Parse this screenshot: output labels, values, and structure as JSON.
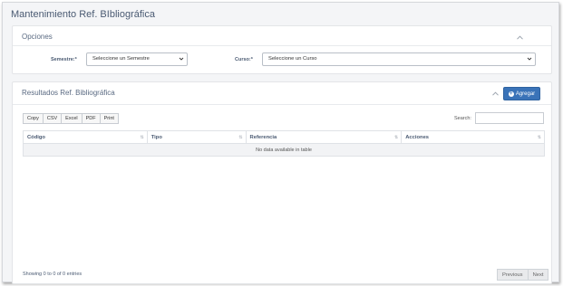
{
  "page": {
    "title": "Mantenimiento Ref. BIbliográfica"
  },
  "opciones": {
    "title": "Opciones",
    "semestre": {
      "label": "Semestre:*",
      "value": "Seleccione un Semestre"
    },
    "curso": {
      "label": "Curso:*",
      "value": "Seleccione un Curso"
    }
  },
  "resultados": {
    "title": "Resultados Ref. Bibliográfica",
    "add_label": "Agregar",
    "export_buttons": [
      "Copy",
      "CSV",
      "Excel",
      "PDF",
      "Print"
    ],
    "search_label": "Search:",
    "search_value": "",
    "columns": [
      "Código",
      "Tipo",
      "Referencia",
      "Acciones"
    ],
    "empty_text": "No data available in table",
    "info": "Showing 0 to 0 of 0 entries",
    "pager": {
      "previous": "Previous",
      "next": "Next"
    }
  },
  "colors": {
    "primary": "#3a73b8",
    "title": "#4a5a72"
  },
  "icons": {
    "collapse": "chevron-up-icon",
    "select_caret": "chevron-down-icon",
    "add": "plus-circle-icon",
    "sort": "sort-icon"
  }
}
